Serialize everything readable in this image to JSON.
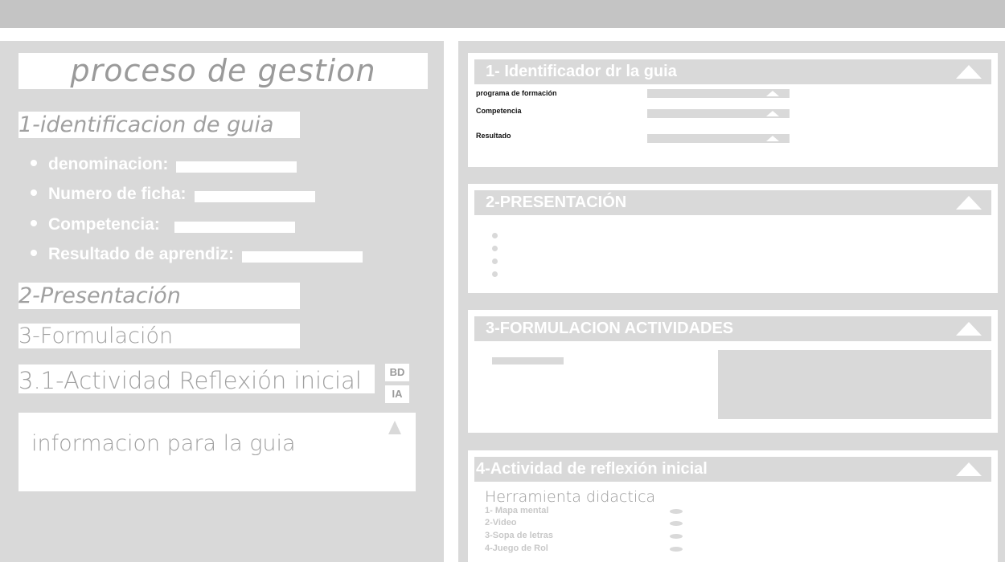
{
  "left": {
    "title": "proceso de gestion",
    "sections": {
      "identificacion": "1-identificacion de guia",
      "presentacion": "2-Presentación",
      "formulacion": "3-Formulación",
      "actividad": "3.1-Actividad Reflexión inicial"
    },
    "bullets": [
      {
        "label": "denominacion:"
      },
      {
        "label": "Numero de ficha:"
      },
      {
        "label": "Competencia:"
      },
      {
        "label": "Resultado de aprendiz:"
      }
    ],
    "badges": {
      "bd": "BD",
      "ia": "IA"
    },
    "info_text": "informacion para la guia"
  },
  "right": {
    "card1": {
      "header": "1- Identificador dr la guia",
      "fields": [
        {
          "label": "programa de formación"
        },
        {
          "label": "Competencia"
        },
        {
          "label": "Resultado"
        }
      ]
    },
    "card2": {
      "header": "2-PRESENTACIÓN"
    },
    "card3": {
      "header": "3-FORMULACION ACTIVIDADES"
    },
    "card4": {
      "header": "4-Actividad de reflexión inicial",
      "tools_title": "Herramienta didactica",
      "tools": [
        {
          "label": "1- Mapa mental"
        },
        {
          "label": "2-Video"
        },
        {
          "label": "3-Sopa de letras"
        },
        {
          "label": "4-Juego de Rol"
        }
      ]
    }
  },
  "colors": {
    "panel_bg": "#d9d9d9",
    "topbar_bg": "#c4c4c4",
    "text_muted": "#a0a0a0"
  }
}
